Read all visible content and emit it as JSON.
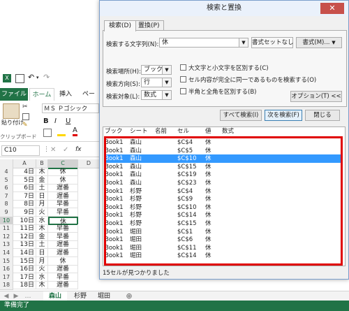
{
  "excel": {
    "quick_access": {
      "save_icon": "save-icon",
      "undo_icon": "undo-icon",
      "redo_icon": "redo-icon"
    },
    "tabs": {
      "file": "ファイル",
      "home": "ホーム",
      "insert": "挿入",
      "page": "ペー"
    },
    "clipboard": {
      "paste": "貼り付け",
      "group": "クリップボード"
    },
    "font": {
      "name": "ＭＳ Ｐゴシック",
      "bold": "B",
      "italic": "I",
      "underline": "U"
    },
    "namebox": "C10",
    "fx": "fx",
    "columns": [
      "A",
      "B",
      "C",
      "D"
    ],
    "rows": [
      {
        "n": "4",
        "a": "4日",
        "b": "木",
        "c": "休"
      },
      {
        "n": "5",
        "a": "5日",
        "b": "金",
        "c": "休"
      },
      {
        "n": "6",
        "a": "6日",
        "b": "土",
        "c": "遅番"
      },
      {
        "n": "7",
        "a": "7日",
        "b": "日",
        "c": "遅番"
      },
      {
        "n": "8",
        "a": "8日",
        "b": "月",
        "c": "早番"
      },
      {
        "n": "9",
        "a": "9日",
        "b": "火",
        "c": "早番"
      },
      {
        "n": "10",
        "a": "10日",
        "b": "水",
        "c": "休"
      },
      {
        "n": "11",
        "a": "11日",
        "b": "木",
        "c": "早番"
      },
      {
        "n": "12",
        "a": "12日",
        "b": "金",
        "c": "早番"
      },
      {
        "n": "13",
        "a": "13日",
        "b": "土",
        "c": "遅番"
      },
      {
        "n": "14",
        "a": "14日",
        "b": "日",
        "c": "遅番"
      },
      {
        "n": "15",
        "a": "15日",
        "b": "月",
        "c": "休"
      },
      {
        "n": "16",
        "a": "16日",
        "b": "火",
        "c": "遅番"
      },
      {
        "n": "17",
        "a": "17日",
        "b": "水",
        "c": "早番"
      },
      {
        "n": "18",
        "a": "18日",
        "b": "木",
        "c": "遅番"
      }
    ],
    "sheets": [
      "森山",
      "杉野",
      "堀田"
    ],
    "status": "準備完了"
  },
  "dialog": {
    "title": "検索と置換",
    "close": "✕",
    "tabs": {
      "find": "検索(D)",
      "replace": "置換(P)"
    },
    "find_label": "検索する文字列(N):",
    "find_value": "休",
    "format_none": "書式セットなし",
    "format_btn": "書式(M)...",
    "within_label": "検索場所(H):",
    "within_value": "ブック",
    "search_label": "検索方向(S):",
    "search_value": "行",
    "lookin_label": "検索対象(L):",
    "lookin_value": "数式",
    "opt_case": "大文字と小文字を区別する(C)",
    "opt_whole": "セル内容が完全に同一であるものを検索する(O)",
    "opt_width": "半角と全角を区別する(B)",
    "options_btn": "オプション(T) <<",
    "find_all": "すべて検索(I)",
    "find_next": "次を検索(F)",
    "close_btn": "閉じる",
    "columns": {
      "book": "ブック",
      "sheet": "シート",
      "name": "名前",
      "cell": "セル",
      "value": "値",
      "formula": "数式"
    },
    "results": [
      {
        "book": "Book1",
        "sheet": "森山",
        "cell": "$C$4",
        "value": "休"
      },
      {
        "book": "Book1",
        "sheet": "森山",
        "cell": "$C$5",
        "value": "休"
      },
      {
        "book": "Book1",
        "sheet": "森山",
        "cell": "$C$10",
        "value": "休"
      },
      {
        "book": "Book1",
        "sheet": "森山",
        "cell": "$C$15",
        "value": "休"
      },
      {
        "book": "Book1",
        "sheet": "森山",
        "cell": "$C$19",
        "value": "休"
      },
      {
        "book": "Book1",
        "sheet": "森山",
        "cell": "$C$23",
        "value": "休"
      },
      {
        "book": "Book1",
        "sheet": "杉野",
        "cell": "$C$4",
        "value": "休"
      },
      {
        "book": "Book1",
        "sheet": "杉野",
        "cell": "$C$9",
        "value": "休"
      },
      {
        "book": "Book1",
        "sheet": "杉野",
        "cell": "$C$10",
        "value": "休"
      },
      {
        "book": "Book1",
        "sheet": "杉野",
        "cell": "$C$14",
        "value": "休"
      },
      {
        "book": "Book1",
        "sheet": "杉野",
        "cell": "$C$15",
        "value": "休"
      },
      {
        "book": "Book1",
        "sheet": "堀田",
        "cell": "$C$1",
        "value": "休"
      },
      {
        "book": "Book1",
        "sheet": "堀田",
        "cell": "$C$6",
        "value": "休"
      },
      {
        "book": "Book1",
        "sheet": "堀田",
        "cell": "$C$11",
        "value": "休"
      },
      {
        "book": "Book1",
        "sheet": "堀田",
        "cell": "$C$14",
        "value": "休"
      }
    ],
    "selected_index": 2,
    "status": "15セルが見つかりました"
  },
  "colors": {
    "excel_green": "#217346",
    "highlight": "#3399ff",
    "annotation_red": "#e00000"
  }
}
